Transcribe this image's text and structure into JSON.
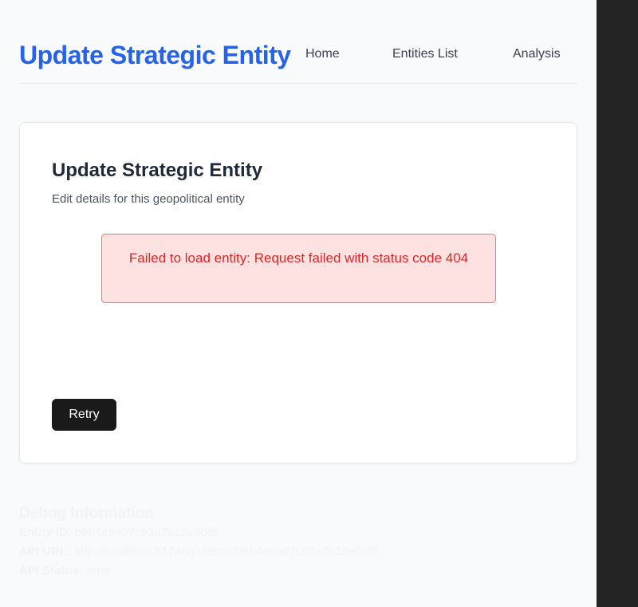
{
  "header": {
    "app_title": "Update Strategic Entity",
    "nav": [
      {
        "label": "Home"
      },
      {
        "label": "Entities List"
      },
      {
        "label": "Analysis"
      }
    ]
  },
  "card": {
    "title": "Update Strategic Entity",
    "subtitle": "Edit details for this geopolitical entity",
    "error_message": "Failed to load entity: Request failed with status code 404",
    "retry_label": "Retry"
  },
  "debug": {
    "title": "Debug Information",
    "entity_id_label": "Entity ID:",
    "entity_id_value": "b6b4e9a07c93a7b19e9bf8",
    "api_url_label": "API URL:",
    "api_url_value": "http://localhost:5174/api/items/b6b4e9a07c93a7b19e9bf8",
    "api_status_label": "API Status:",
    "api_status_value": "error"
  },
  "colors": {
    "accent": "#2563eb",
    "error_bg": "#fee2e2",
    "error_text": "#dc2626",
    "button_bg": "#1a1a1a"
  }
}
